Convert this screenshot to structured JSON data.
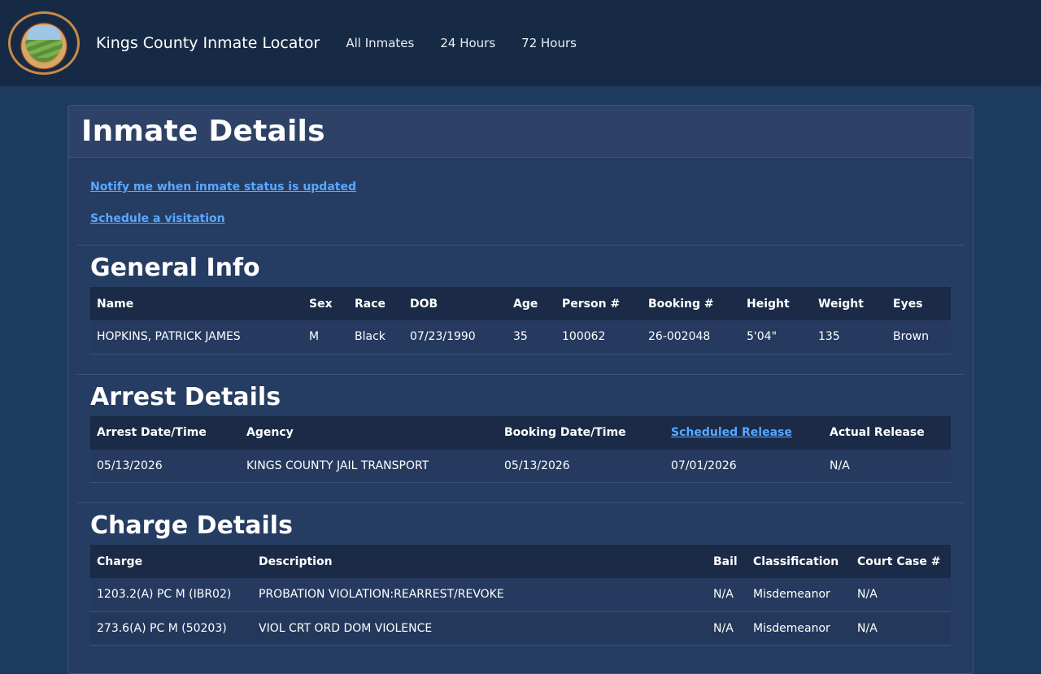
{
  "header": {
    "brand": "Kings County Inmate Locator",
    "nav": [
      "All Inmates",
      "24 Hours",
      "72 Hours"
    ]
  },
  "page": {
    "title": "Inmate Details",
    "links": [
      "Notify me when inmate status is updated",
      "Schedule a visitation"
    ]
  },
  "general": {
    "title": "General Info",
    "headers": [
      "Name",
      "Sex",
      "Race",
      "DOB",
      "Age",
      "Person #",
      "Booking #",
      "Height",
      "Weight",
      "Eyes"
    ],
    "row": [
      "HOPKINS, PATRICK JAMES",
      "M",
      "Black",
      "07/23/1990",
      "35",
      "100062",
      "26-002048",
      "5'04\"",
      "135",
      "Brown"
    ]
  },
  "arrest": {
    "title": "Arrest Details",
    "headers": [
      "Arrest Date/Time",
      "Agency",
      "Booking Date/Time",
      "Scheduled Release",
      "Actual Release"
    ],
    "row": [
      "05/13/2026",
      "KINGS COUNTY JAIL TRANSPORT",
      "05/13/2026",
      "07/01/2026",
      "N/A"
    ]
  },
  "charges": {
    "title": "Charge Details",
    "headers": [
      "Charge",
      "Description",
      "Bail",
      "Classification",
      "Court Case #"
    ],
    "rows": [
      [
        "1203.2(A) PC M (IBR02)",
        "PROBATION VIOLATION:REARREST/REVOKE",
        "N/A",
        "Misdemeanor",
        "N/A"
      ],
      [
        "273.6(A) PC M (50203)",
        "VIOL CRT ORD DOM VIOLENCE",
        "N/A",
        "Misdemeanor",
        "N/A"
      ]
    ]
  },
  "colors": {
    "page_bg": "#1d3a5f",
    "topbar": "#172a45",
    "link": "#5aa8ff",
    "table_header": "#1a2a47"
  }
}
